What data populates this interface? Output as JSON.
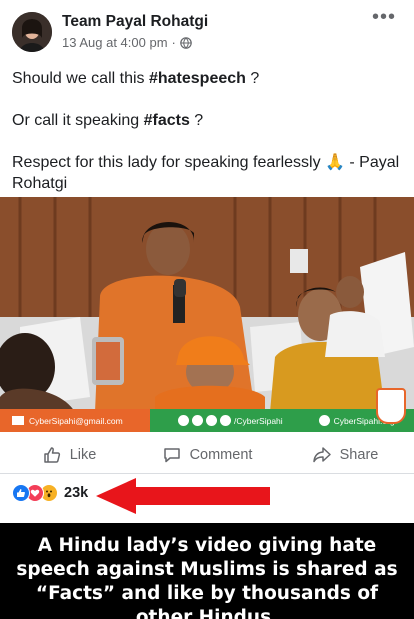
{
  "post": {
    "author": "Team Payal Rohatgi",
    "timestamp": "13 Aug at 4:00 pm",
    "privacy_icon": "globe-icon",
    "more_icon": "more-options-icon",
    "text": {
      "line1_prefix": "Should we call this ",
      "line1_tag": "#hatespeech",
      "line1_suffix": " ?",
      "line2_prefix": "Or call it speaking ",
      "line2_tag": "#facts",
      "line2_suffix": " ?",
      "line3": "Respect for this lady for speaking fearlessly 🙏 - Payal Rohatgi"
    }
  },
  "video": {
    "email": "CyberSipahi@gmail.com",
    "social_handle": "/CyberSipahi",
    "website": "CyberSipahi.org"
  },
  "actions": {
    "like": "Like",
    "comment": "Comment",
    "share": "Share"
  },
  "reactions": {
    "count": "23k",
    "icons": [
      "like-icon",
      "love-icon",
      "wow-icon"
    ]
  },
  "colors": {
    "facebook_blue": "#1877f2",
    "arrow_red": "#e8151b",
    "caption_bg": "#000000",
    "video_bar_orange": "#e8662a",
    "video_bar_green": "#2e9e4a"
  },
  "caption": {
    "text": "A Hindu lady’s video giving hate speech against Muslims is shared as “Facts” and like by thousands of other Hindus."
  }
}
